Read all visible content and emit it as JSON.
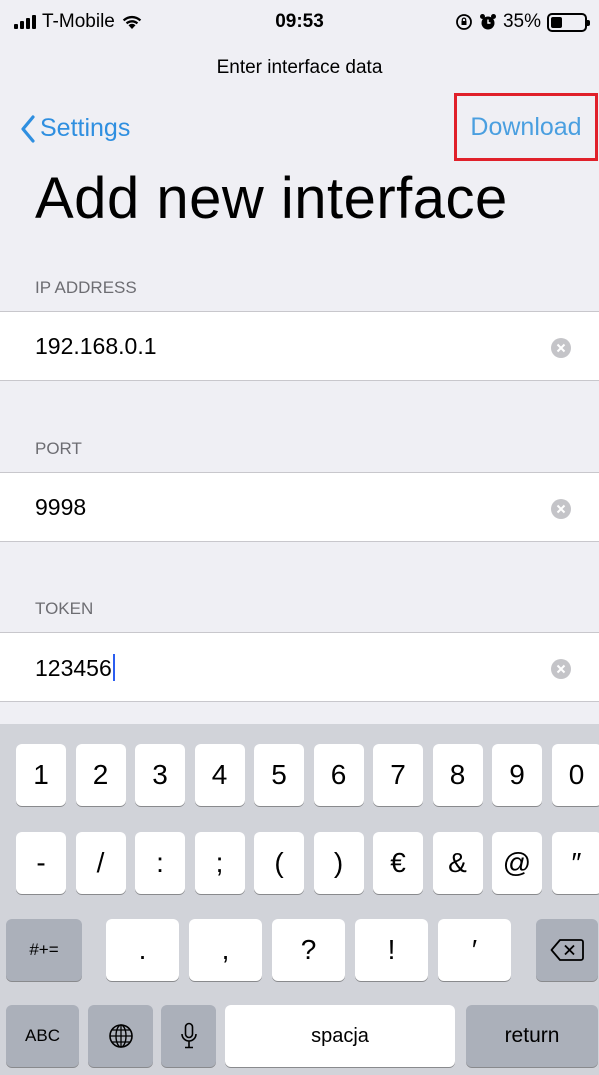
{
  "status": {
    "carrier": "T-Mobile",
    "time": "09:53",
    "battery_text": "35%",
    "battery_level": 0.35
  },
  "nav": {
    "title": "Enter interface data",
    "back_label": "Settings",
    "action_label": "Download"
  },
  "page_title": "Add new interface",
  "fields": [
    {
      "label": "IP ADDRESS",
      "value": "192.168.0.1"
    },
    {
      "label": "PORT",
      "value": "9998"
    },
    {
      "label": "TOKEN",
      "value": "123456"
    }
  ],
  "keyboard": {
    "row1": [
      "1",
      "2",
      "3",
      "4",
      "5",
      "6",
      "7",
      "8",
      "9",
      "0"
    ],
    "row2": [
      "-",
      "/",
      ":",
      ";",
      "(",
      ")",
      "€",
      "&",
      "@",
      "″"
    ],
    "row3": [
      "#+=",
      ".",
      ",",
      "?",
      "!",
      "′"
    ],
    "row4": {
      "abc": "ABC",
      "space": "spacja",
      "return": "return"
    }
  },
  "colors": {
    "accent": "#2f8fe0",
    "highlight_border": "#e0202a",
    "background": "#efeff4"
  }
}
